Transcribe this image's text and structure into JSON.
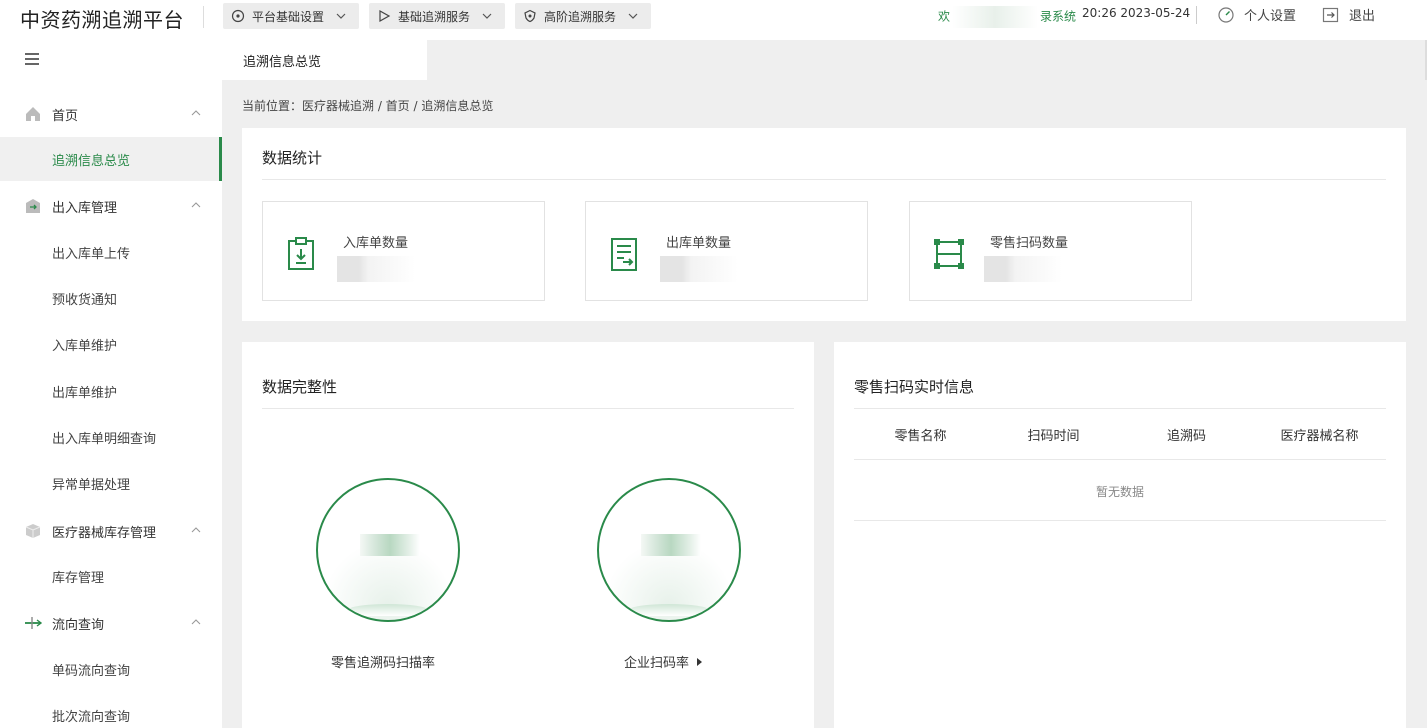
{
  "header": {
    "app_title": "中资药溯追溯平台",
    "nav": [
      {
        "label": "平台基础设置",
        "icon": "network-icon"
      },
      {
        "label": "基础追溯服务",
        "icon": "play-icon"
      },
      {
        "label": "高阶追溯服务",
        "icon": "shield-icon"
      }
    ],
    "welcome_prefix": "欢",
    "welcome_suffix": "录系统",
    "datetime": "20:26 2023-05-24",
    "personal_settings": "个人设置",
    "logout": "退出"
  },
  "sidebar": {
    "groups": [
      {
        "label": "首页",
        "icon": "home-icon",
        "items": [
          "追溯信息总览"
        ]
      },
      {
        "label": "出入库管理",
        "icon": "warehouse-icon",
        "items": [
          "出入库单上传",
          "预收货通知",
          "入库单维护",
          "出库单维护",
          "出入库单明细查询",
          "异常单据处理"
        ]
      },
      {
        "label": "医疗器械库存管理",
        "icon": "box-icon",
        "items": [
          "库存管理"
        ]
      },
      {
        "label": "流向查询",
        "icon": "flow-icon",
        "items": [
          "单码流向查询",
          "批次流向查询"
        ]
      }
    ],
    "active_item": "追溯信息总览"
  },
  "tabs": {
    "active": "追溯信息总览"
  },
  "breadcrumb": "当前位置：医疗器械追溯 / 首页 / 追溯信息总览",
  "stats": {
    "title": "数据统计",
    "boxes": [
      {
        "label": "入库单数量",
        "icon": "inbound-clipboard-icon"
      },
      {
        "label": "出库单数量",
        "icon": "outbound-document-icon"
      },
      {
        "label": "零售扫码数量",
        "icon": "scan-frame-icon"
      }
    ]
  },
  "integrity": {
    "title": "数据完整性",
    "gauges": [
      {
        "label": "零售追溯码扫描率"
      },
      {
        "label": "企业扫码率"
      }
    ]
  },
  "realtime": {
    "title": "零售扫码实时信息",
    "columns": [
      "零售名称",
      "扫码时间",
      "追溯码",
      "医疗器械名称"
    ],
    "empty_text": "暂无数据"
  },
  "colors": {
    "accent": "#2a8a4a"
  }
}
